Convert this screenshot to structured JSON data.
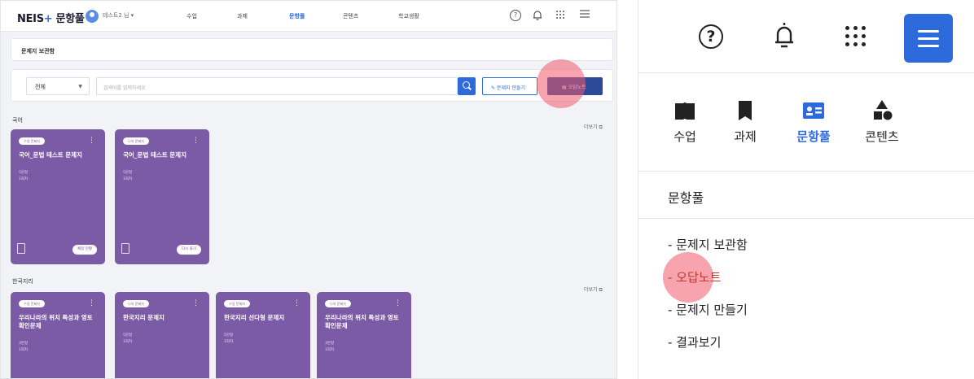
{
  "left": {
    "brand": {
      "name": "NEIS",
      "plus": "+",
      "product": "문항풀"
    },
    "user_name": "테스트2 님 ▾",
    "nav": [
      "수업",
      "과제",
      "문항풀",
      "콘텐츠",
      "학교생활"
    ],
    "nav_active_index": 2,
    "breadcrumb": "문제지 보관함",
    "filter": {
      "selected": "전체"
    },
    "search": {
      "placeholder": "검색어를 입력하세요"
    },
    "buttons": {
      "make": "✎ 문제지 만들기",
      "wrong_note": "▤ 오답노트"
    },
    "sections": [
      {
        "title": "국어",
        "more": "더보기 ⧉",
        "cards": [
          {
            "tag": "수업 문제지",
            "title": "국어_문법 테스트 문제지",
            "meta1": "5문항",
            "meta2": "1회차",
            "action": "채점 현황"
          },
          {
            "tag": "나의 문제지",
            "title": "국어_문법 테스트 문제지",
            "meta1": "5문항",
            "meta2": "1회차",
            "action": "다시 풀기"
          }
        ]
      },
      {
        "title": "한국지리",
        "more": "더보기 ⧉",
        "cards": [
          {
            "tag": "수업 문제지",
            "title": "우리나라의 위치 특성과 영토 확인문제",
            "meta1": "3문항",
            "meta2": "1회차"
          },
          {
            "tag": "나의 문제지",
            "title": "한국지리 문제지",
            "meta1": "5문항",
            "meta2": "1회차"
          },
          {
            "tag": "수업 문제지",
            "title": "한국지리 선다형 문제지",
            "meta1": "5문항",
            "meta2": "1회차"
          },
          {
            "tag": "나의 문제지",
            "title": "우리나라의 위치 특성과 영토 확인문제",
            "meta1": "3문항",
            "meta2": "1회차"
          }
        ]
      }
    ]
  },
  "right": {
    "nav": [
      {
        "label": "수업",
        "icon": "book-icon"
      },
      {
        "label": "과제",
        "icon": "bookmark-icon"
      },
      {
        "label": "문항풀",
        "icon": "id-card-icon"
      },
      {
        "label": "콘텐츠",
        "icon": "shapes-icon"
      }
    ],
    "nav_active_index": 2,
    "section_head": "문항풀",
    "sub_items": [
      "- 문제지 보관함",
      "- 오답노트",
      "- 문제지 만들기",
      "- 결과보기"
    ],
    "highlighted_sub_index": 1
  },
  "colors": {
    "accent": "#2d6bdc",
    "card": "#7b5aa6",
    "highlight": "#f05a6e"
  }
}
